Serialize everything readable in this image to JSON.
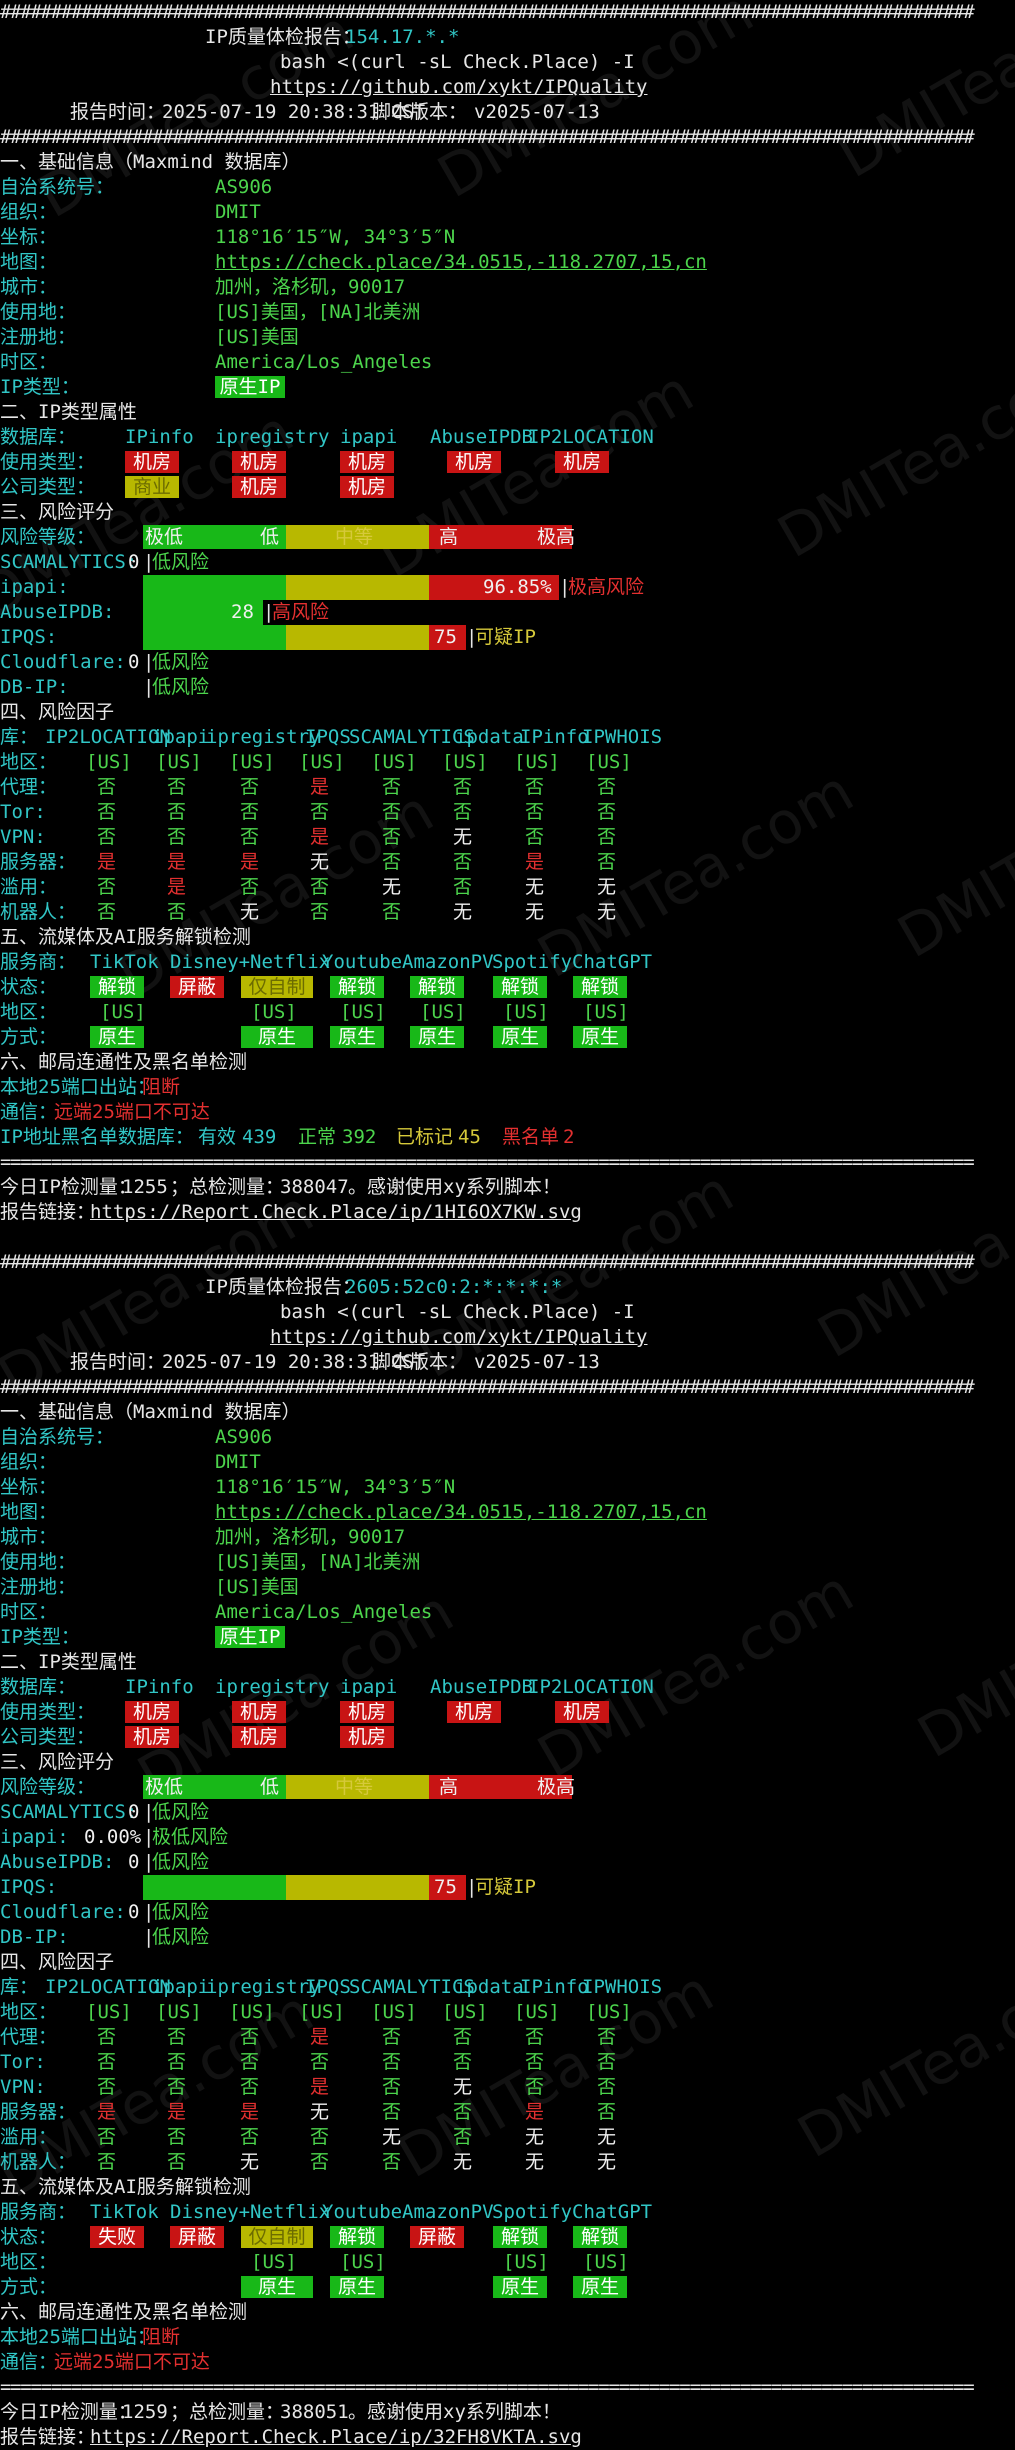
{
  "watermark": "DMITea.com",
  "hash_line": "################################################################################################",
  "eq_line": "================================================================================================",
  "labels": {
    "title_prefix": "IP质量体检报告：",
    "command": "bash <(curl -sL Check.Place) -I",
    "repo": "https://github.com/xykt/IPQuality",
    "time_prefix": "报告时间：",
    "version_prefix": "脚本版本：",
    "sec1": "一、基础信息（Maxmind 数据库）",
    "asn": "自治系统号：",
    "org": "组织：",
    "coord": "坐标：",
    "map": "地图：",
    "city": "城市：",
    "usage_region": "使用地：",
    "reg_region": "注册地：",
    "tz": "时区：",
    "iptype": "IP类型：",
    "sec2": "二、IP类型属性",
    "db": "数据库：",
    "use_type": "使用类型：",
    "company_type": "公司类型：",
    "sec3": "三、风险评分",
    "risk_level": "风险等级：",
    "sec4": "四、风险因子",
    "lib": "库：",
    "sec5": "五、流媒体及AI服务解锁检测",
    "service": "服务商：",
    "status": "状态：",
    "region": "地区：",
    "method": "方式：",
    "sec6": "六、邮局连通性及黑名单检测",
    "port25": "本地25端口出站：",
    "comm": "通信：",
    "blacklist": "IP地址黑名单数据库：",
    "bl_valid": "有效",
    "bl_normal": "正常",
    "bl_marked": "已标记",
    "bl_black": "黑名单",
    "footer_prefix": "今日IP检测量：",
    "footer_mid": "；总检测量：",
    "footer_suffix": "。感谢使用xy系列脚本！",
    "link_prefix": "报告链接："
  },
  "risk_scale": [
    "极低",
    "低",
    "中等",
    "高",
    "极高"
  ],
  "risk_rows": [
    "SCAMALYTICS:",
    "ipapi:",
    "AbuseIPDB:",
    "IPQS:",
    "Cloudflare:",
    "DB-IP:"
  ],
  "type_dbs": [
    "IPinfo",
    "ipregistry",
    "ipapi",
    "AbuseIPDB",
    "IP2LOCATION"
  ],
  "factor_dbs": [
    "IP2LOCATION",
    "ipapi",
    "ipregistry",
    "IPQS",
    "SCAMALYTICS",
    "ipdata",
    "IPinfo",
    "IPWHOIS"
  ],
  "factor_rows": [
    "代理：",
    "Tor:",
    "VPN:",
    "服务器：",
    "滥用：",
    "机器人："
  ],
  "services": [
    "TikTok",
    "Disney+",
    "Netflix",
    "Youtube",
    "AmazonPV",
    "Spotify",
    "ChatGPT"
  ],
  "colors": {
    "cyan": "#31c6c6",
    "green": "#18b818",
    "red": "#c81414",
    "yellow": "#b8b800"
  },
  "reports": [
    {
      "ip": "154.17.*.*",
      "time": "2025-07-19 20:38:31 CST",
      "version": "v2025-07-13",
      "asn": "AS906",
      "org": "DMIT",
      "coord": "118°16′15″W, 34°3′5″N",
      "map": "https://check.place/34.0515,-118.2707,15,cn",
      "city": "加州，洛杉矶，90017",
      "usage_region": "[US]美国，[NA]北美洲",
      "reg_region": "[US]美国",
      "tz": "America/Los_Angeles",
      "iptype": "原生IP",
      "use_types": [
        "机房",
        "机房",
        "机房",
        "机房",
        "机房"
      ],
      "company_types": [
        "商业",
        "机房",
        "机房"
      ],
      "scores": [
        {
          "value": "0",
          "level": "低风险",
          "pct": 0
        },
        {
          "value": "96.85%",
          "level": "极高风险",
          "pct": 96.85
        },
        {
          "value": "28",
          "level": "高风险",
          "pct": 28
        },
        {
          "value": "75",
          "level": "可疑IP",
          "pct": 75
        },
        {
          "value": "0",
          "level": "低风险",
          "pct": 0
        },
        {
          "value": "",
          "level": "低风险",
          "pct": 0
        }
      ],
      "factors": [
        [
          "[US]",
          "[US]",
          "[US]",
          "[US]",
          "[US]",
          "[US]",
          "[US]",
          "[US]"
        ],
        [
          "否",
          "否",
          "否",
          "是",
          "否",
          "否",
          "否",
          "否"
        ],
        [
          "否",
          "否",
          "否",
          "否",
          "否",
          "否",
          "否",
          "否"
        ],
        [
          "否",
          "否",
          "否",
          "是",
          "否",
          "无",
          "否",
          "否"
        ],
        [
          "是",
          "是",
          "是",
          "无",
          "否",
          "否",
          "是",
          "否"
        ],
        [
          "否",
          "是",
          "否",
          "否",
          "无",
          "否",
          "无",
          "无"
        ],
        [
          "否",
          "否",
          "无",
          "否",
          "否",
          "无",
          "无",
          "无"
        ]
      ],
      "media_status": [
        "解锁",
        "屏蔽",
        "仅自制",
        "解锁",
        "解锁",
        "解锁",
        "解锁"
      ],
      "media_region": [
        "[US]",
        "",
        "[US]",
        "[US]",
        "[US]",
        "[US]",
        "[US]"
      ],
      "media_method": [
        "原生",
        "",
        "原生",
        "原生",
        "原生",
        "原生",
        "原生"
      ],
      "port25": "阻断",
      "comm": "远端25端口不可达",
      "blacklist": {
        "valid": "439",
        "normal": "392",
        "marked": "45",
        "black": "2"
      },
      "today": "1255",
      "total": "388047",
      "link": "https://Report.Check.Place/ip/1HI6OX7KW.svg"
    },
    {
      "ip": "2605:52c0:2:*:*:*:*",
      "time": "2025-07-19 20:38:31 CST",
      "version": "v2025-07-13",
      "asn": "AS906",
      "org": "DMIT",
      "coord": "118°16′15″W, 34°3′5″N",
      "map": "https://check.place/34.0515,-118.2707,15,cn",
      "city": "加州，洛杉矶，90017",
      "usage_region": "[US]美国，[NA]北美洲",
      "reg_region": "[US]美国",
      "tz": "America/Los_Angeles",
      "iptype": "原生IP",
      "use_types": [
        "机房",
        "机房",
        "机房",
        "机房",
        "机房"
      ],
      "company_types": [
        "机房",
        "机房",
        "机房"
      ],
      "scores": [
        {
          "value": "0",
          "level": "低风险",
          "pct": 0
        },
        {
          "value": "0.00%",
          "level": "极低风险",
          "pct": 0
        },
        {
          "value": "0",
          "level": "低风险",
          "pct": 0
        },
        {
          "value": "75",
          "level": "可疑IP",
          "pct": 75
        },
        {
          "value": "0",
          "level": "低风险",
          "pct": 0
        },
        {
          "value": "",
          "level": "低风险",
          "pct": 0
        }
      ],
      "factors": [
        [
          "[US]",
          "[US]",
          "[US]",
          "[US]",
          "[US]",
          "[US]",
          "[US]",
          "[US]"
        ],
        [
          "否",
          "否",
          "否",
          "是",
          "否",
          "否",
          "否",
          "否"
        ],
        [
          "否",
          "否",
          "否",
          "否",
          "否",
          "否",
          "否",
          "否"
        ],
        [
          "否",
          "否",
          "否",
          "是",
          "否",
          "无",
          "否",
          "否"
        ],
        [
          "是",
          "是",
          "是",
          "无",
          "否",
          "否",
          "是",
          "否"
        ],
        [
          "否",
          "否",
          "否",
          "否",
          "无",
          "否",
          "无",
          "无"
        ],
        [
          "否",
          "否",
          "无",
          "否",
          "否",
          "无",
          "无",
          "无"
        ]
      ],
      "media_status": [
        "失败",
        "屏蔽",
        "仅自制",
        "解锁",
        "屏蔽",
        "解锁",
        "解锁"
      ],
      "media_region": [
        "",
        "",
        "[US]",
        "[US]",
        "",
        "[US]",
        "[US]"
      ],
      "media_method": [
        "",
        "",
        "原生",
        "原生",
        "",
        "原生",
        "原生"
      ],
      "port25": "阻断",
      "comm": "远端25端口不可达",
      "blacklist": null,
      "today": "1259",
      "total": "388051",
      "link": "https://Report.Check.Place/ip/32FH8VKTA.svg"
    }
  ]
}
